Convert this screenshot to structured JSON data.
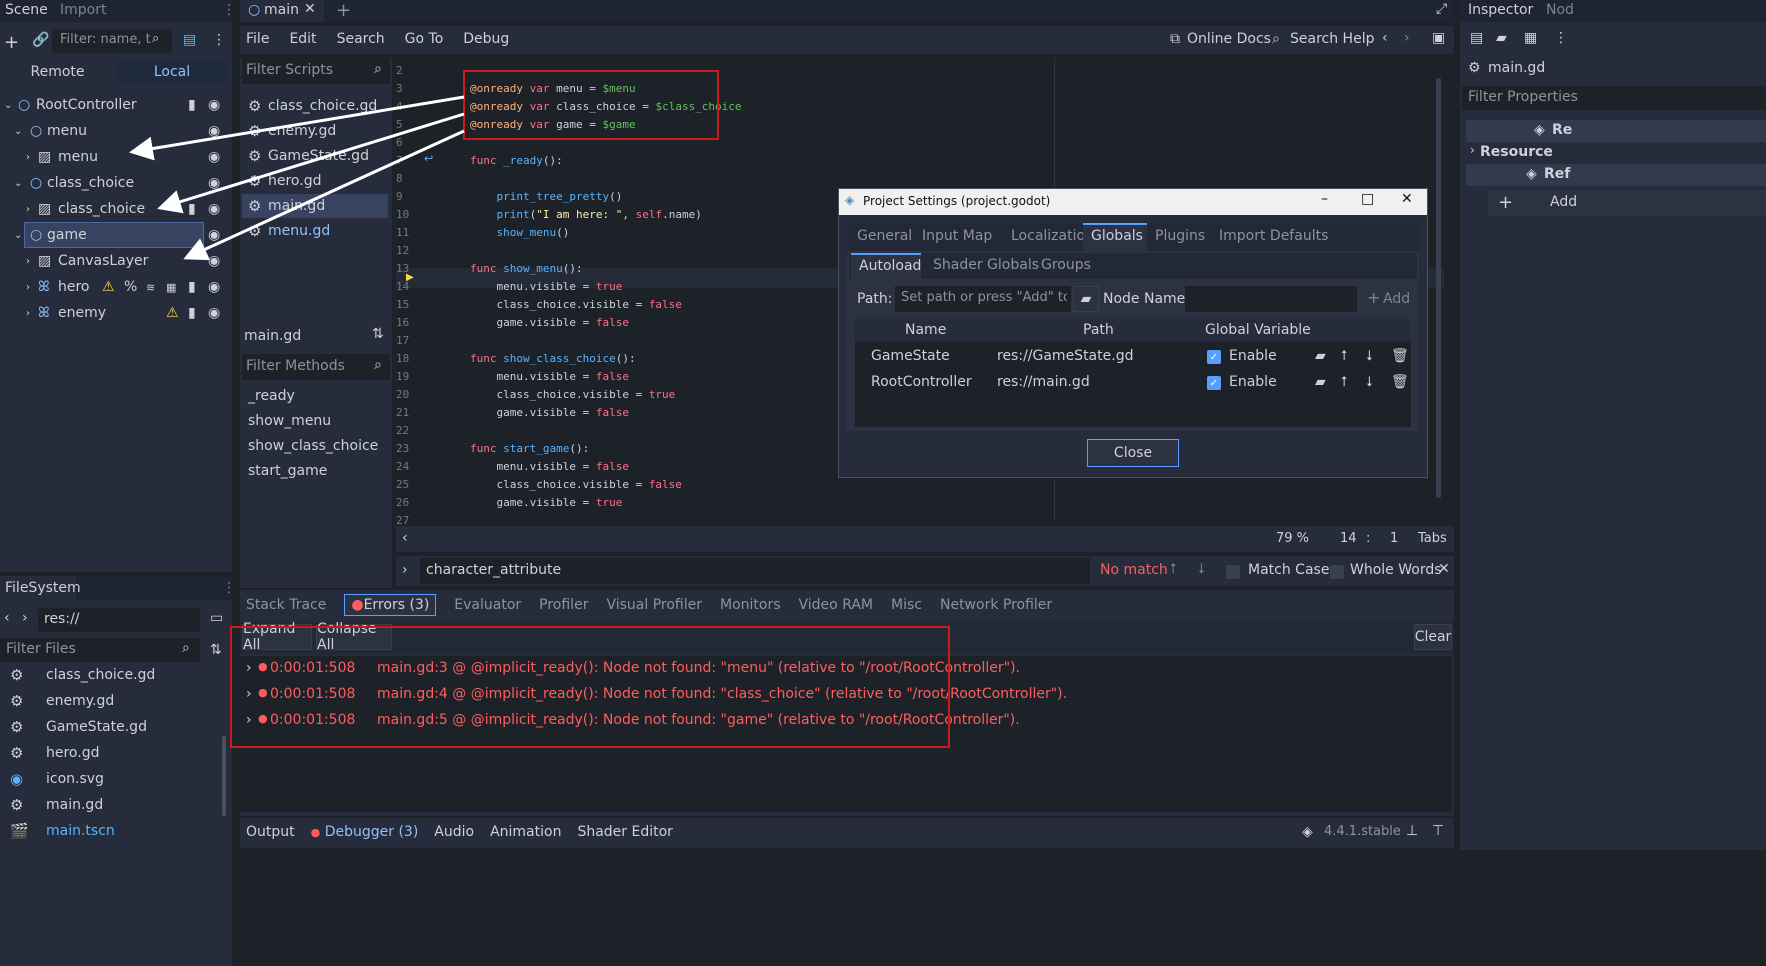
{
  "scene_dock": {
    "tab_scene": "Scene",
    "tab_import": "Import",
    "filter_placeholder": "Filter: name, t:t",
    "remote": "Remote",
    "local": "Local",
    "tree": [
      {
        "label": "RootController"
      },
      {
        "label": "menu"
      },
      {
        "label": "menu"
      },
      {
        "label": "class_choice"
      },
      {
        "label": "class_choice"
      },
      {
        "label": "game"
      },
      {
        "label": "CanvasLayer"
      },
      {
        "label": "hero"
      },
      {
        "label": "enemy"
      }
    ]
  },
  "filesystem": {
    "title": "FileSystem",
    "path": "res://",
    "filter_placeholder": "Filter Files",
    "files": [
      "class_choice.gd",
      "enemy.gd",
      "GameState.gd",
      "hero.gd",
      "icon.svg",
      "main.gd",
      "main.tscn"
    ]
  },
  "top": {
    "main_tab": "main",
    "menu": [
      "File",
      "Edit",
      "Search",
      "Go To",
      "Debug"
    ],
    "online_docs": "Online Docs",
    "search_help": "Search Help"
  },
  "scripts": {
    "filter_placeholder": "Filter Scripts",
    "items": [
      "class_choice.gd",
      "enemy.gd",
      "GameState.gd",
      "hero.gd",
      "main.gd",
      "menu.gd"
    ],
    "current": "main.gd",
    "methods_placeholder": "Filter Methods",
    "methods": [
      "_ready",
      "show_menu",
      "show_class_choice",
      "start_game"
    ]
  },
  "code": {
    "line_numbers": [
      "2",
      "3",
      "4",
      "5",
      "6",
      "7",
      "8",
      "9",
      "10",
      "11",
      "12",
      "13",
      "14",
      "15",
      "16",
      "17",
      "18",
      "19",
      "20",
      "21",
      "22",
      "23",
      "24",
      "25",
      "26",
      "27"
    ],
    "zoom": "79 %",
    "line": "14",
    "col": "1",
    "indent": "Tabs"
  },
  "find": {
    "query": "character_attribute",
    "status": "No match",
    "match_case": "Match Case",
    "whole_words": "Whole Words"
  },
  "debugger": {
    "tabs": [
      "Stack Trace",
      "Errors (3)",
      "Evaluator",
      "Profiler",
      "Visual Profiler",
      "Monitors",
      "Video RAM",
      "Misc",
      "Network Profiler"
    ],
    "expand_all": "Expand All",
    "collapse_all": "Collapse All",
    "clear": "Clear",
    "errors": [
      {
        "time": "0:00:01:508",
        "msg": "main.gd:3 @ @implicit_ready(): Node not found: \"menu\" (relative to \"/root/RootController\")."
      },
      {
        "time": "0:00:01:508",
        "msg": "main.gd:4 @ @implicit_ready(): Node not found: \"class_choice\" (relative to \"/root/RootController\")."
      },
      {
        "time": "0:00:01:508",
        "msg": "main.gd:5 @ @implicit_ready(): Node not found: \"game\" (relative to \"/root/RootController\")."
      }
    ]
  },
  "bottom_bar": {
    "items": [
      "Output",
      "Debugger (3)",
      "Audio",
      "Animation",
      "Shader Editor"
    ],
    "version": "4.4.1.stable"
  },
  "inspector": {
    "tab": "Inspector",
    "tab2": "Nod",
    "file": "main.gd",
    "filter_placeholder": "Filter Properties",
    "ref1": "Re",
    "resource": "Resource",
    "ref2": "Ref",
    "add": "Add"
  },
  "dialog": {
    "title": "Project Settings (project.godot)",
    "tabs": [
      "General",
      "Input Map",
      "Localization",
      "Globals",
      "Plugins",
      "Import Defaults"
    ],
    "subtabs": [
      "Autoload",
      "Shader Globals",
      "Groups"
    ],
    "path_label": "Path:",
    "path_placeholder": "Set path or press \"Add\" to c",
    "node_name_label": "Node Name:",
    "add": "Add",
    "headers": [
      "Name",
      "Path",
      "Global Variable"
    ],
    "rows": [
      {
        "name": "GameState",
        "path": "res://GameState.gd",
        "enable": "Enable"
      },
      {
        "name": "RootController",
        "path": "res://main.gd",
        "enable": "Enable"
      }
    ],
    "close": "Close"
  },
  "colors": {
    "accent": "#569eff",
    "error": "#ff5d5d",
    "highlight_box": "#c91b1b"
  }
}
